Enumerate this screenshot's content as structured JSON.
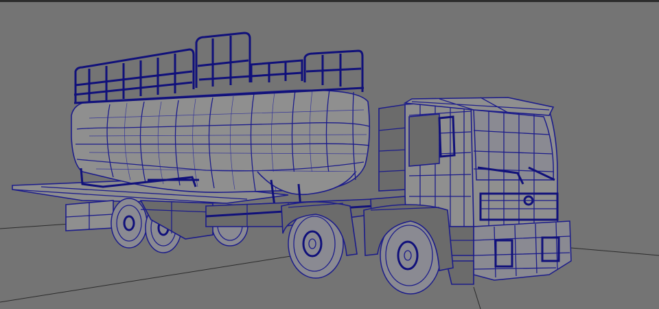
{
  "viewport": {
    "background": "#747474",
    "wire_color": "#1b1b8a",
    "grid_color": "#2a2a2a"
  },
  "model": {
    "icon": "truck-wireframe-icon"
  }
}
